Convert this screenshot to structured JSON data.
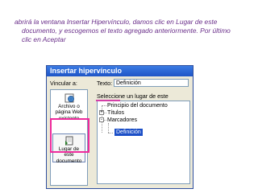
{
  "caption": {
    "line1": "abrirá la ventana Insertar Hipervínculo, damos clic en Lugar de este",
    "line2": "documento, y escogemos el texto agregado anteriormente. Por último",
    "line3": "clic en Aceptar"
  },
  "dialog": {
    "title": "Insertar hipervínculo",
    "link_to_label": "Vincular a:",
    "text_label": "Texto:",
    "text_value": "Definición",
    "nav": [
      {
        "label": "Archivo o página Web existente",
        "icon": "globe-icon"
      },
      {
        "label": "Lugar de este documento",
        "icon": "document-icon"
      }
    ],
    "select_place_label": "Seleccione un lugar de este documento:",
    "tree": [
      {
        "label": "Principio del documento"
      },
      {
        "label": "Títulos",
        "expander": "+"
      },
      {
        "label": "Marcadores",
        "expander": "-"
      },
      {
        "label": "Definición",
        "selected": true
      }
    ]
  },
  "colors": {
    "caption": "#6a2f8a",
    "highlight_box": "#ee2a9c",
    "selection": "#1c4fc7",
    "titlebar": "#2563d6"
  }
}
